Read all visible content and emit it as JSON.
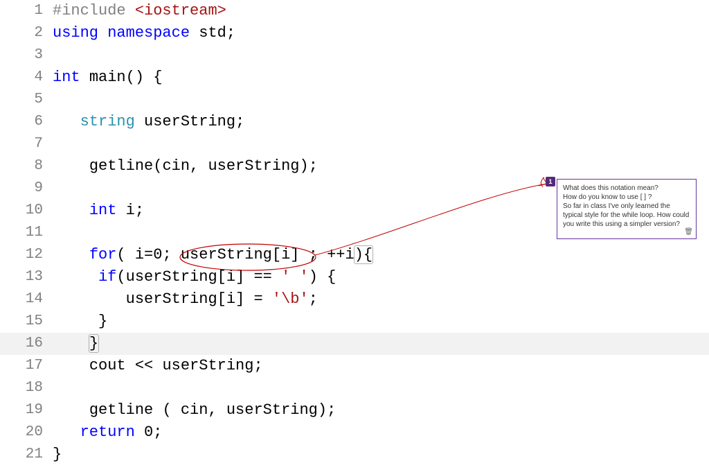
{
  "lines": {
    "1": {
      "n": "1"
    },
    "2": {
      "n": "2"
    },
    "3": {
      "n": "3"
    },
    "4": {
      "n": "4"
    },
    "5": {
      "n": "5"
    },
    "6": {
      "n": "6"
    },
    "7": {
      "n": "7"
    },
    "8": {
      "n": "8"
    },
    "9": {
      "n": "9"
    },
    "10": {
      "n": "10"
    },
    "11": {
      "n": "11"
    },
    "12": {
      "n": "12"
    },
    "13": {
      "n": "13"
    },
    "14": {
      "n": "14"
    },
    "15": {
      "n": "15"
    },
    "16": {
      "n": "16"
    },
    "17": {
      "n": "17"
    },
    "18": {
      "n": "18"
    },
    "19": {
      "n": "19"
    },
    "20": {
      "n": "20"
    },
    "21": {
      "n": "21"
    }
  },
  "tok": {
    "include_hash": "#include",
    "iostream": " <iostream>",
    "using": "using",
    "namespace": "namespace",
    "std": "std",
    "semi": ";",
    "int": "int",
    "main": "main",
    "parens": "()",
    "lbrace": " {",
    "rbrace": "}",
    "string": "string",
    "userString": "userString",
    "getline": "getline",
    "cin": "cin",
    "comma_sp": ", ",
    "int_i": "i",
    "for": "for",
    "i_eq": "i",
    "eq": "=",
    "zero": "0",
    "lbrack": "[",
    "rbrack": "]",
    "plusplus": "++",
    "if": "if",
    "eqeq": "==",
    "sp_char": "' '",
    "assign": "=",
    "bs_char": "'\\b'",
    "cout": "cout",
    "ltlt": "<<",
    "return": "return",
    "sp": " ",
    "lparen": "(",
    "rparen": ")",
    "rparen_lbrace": "){",
    "rparen_sp_lbrace": ") {"
  },
  "annotation": {
    "badge": "1",
    "line1": "What does this notation mean?",
    "line2": "How do you know to use [ ] ?",
    "line3": "So far in class I've only learned the typical style for the while loop. How could you write this using a simpler version?"
  }
}
